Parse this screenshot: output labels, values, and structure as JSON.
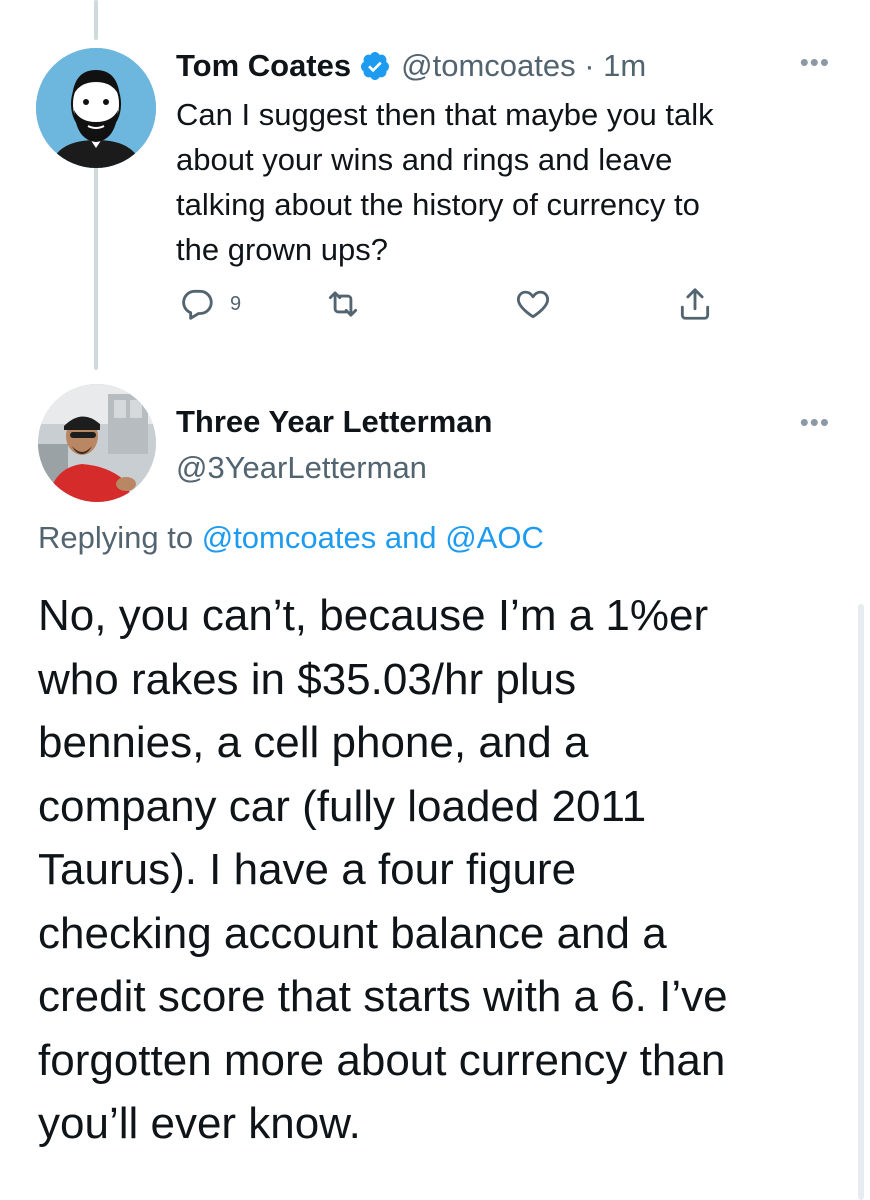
{
  "tweet1": {
    "display_name": "Tom Coates",
    "handle": "@tomcoates",
    "time": "1m",
    "text": "Can I suggest then that maybe you talk\nabout your wins and rings and leave\ntalking about the history of currency to\nthe grown ups?",
    "reply_count": "9",
    "avatar_icon": "cartoon-bearded-man-avatar",
    "avatar_bg": "#6db7de"
  },
  "tweet2": {
    "display_name": "Three Year Letterman",
    "handle": "@3YearLetterman",
    "replying_prefix": "Replying to",
    "replying_to_1": "@tomcoates",
    "replying_and": "and",
    "replying_to_2": "@AOC",
    "text": "No, you can’t, because I’m a 1%er\nwho rakes in $35.03/hr plus\nbennies, a cell phone, and a\ncompany car (fully loaded 2011\nTaurus). I have a four figure\nchecking account balance and a\ncredit score that starts with a 6. I’ve\nforgotten more about currency than\nyou’ll ever know.",
    "avatar_icon": "photo-man-in-red-shirt-avatar"
  },
  "icons": {
    "more": "more-horizontal-icon",
    "verified": "verified-badge-icon",
    "reply": "reply-icon",
    "retweet": "retweet-icon",
    "like": "heart-icon",
    "share": "share-icon"
  },
  "colors": {
    "text": "#0f1419",
    "secondary": "#536471",
    "accent": "#1d9bf0",
    "thread_line": "#cfd9de"
  }
}
